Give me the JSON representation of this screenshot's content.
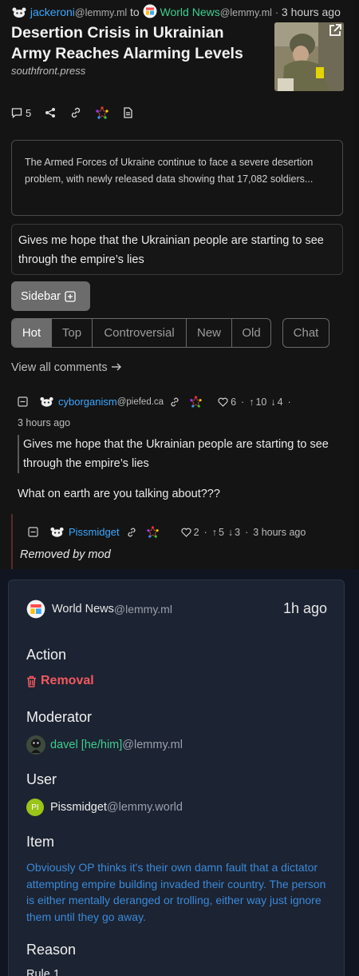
{
  "post": {
    "author": "jackeroni",
    "author_instance": "@lemmy.ml",
    "to_label": "to",
    "community": "World News",
    "community_instance": "@lemmy.ml",
    "time": "3 hours ago",
    "title": "Desertion Crisis in Ukrainian Army Reaches Alarming Levels",
    "source": "southfront.press",
    "comment_count": "5",
    "excerpt": "The Armed Forces of Ukraine continue to face a severe desertion problem, with newly released data showing that 17,082 soldiers...",
    "body": "Gives me hope that the Ukrainian people are starting to see through the empire’s lies"
  },
  "sidebar_label": "Sidebar",
  "sort_tabs": [
    "Hot",
    "Top",
    "Controversial",
    "New",
    "Old"
  ],
  "chat_label": "Chat",
  "view_all": "View all comments",
  "comments": [
    {
      "user": "cyborganism",
      "instance": "@piefed.ca",
      "upvotes_label": "6",
      "up": "10",
      "down": "4",
      "sep": "·",
      "time": "3 hours ago",
      "quote": "Gives me hope that the Ukrainian people are starting to see through the empire’s lies",
      "text": "What on earth are you talking about???"
    },
    {
      "user": "Pissmidget",
      "hearts": "2",
      "up": "5",
      "down": "3",
      "sep": "·",
      "time": "3 hours ago",
      "text": "Removed by mod"
    }
  ],
  "modlog": {
    "community": "World News",
    "community_instance": "@lemmy.ml",
    "time": "1h ago",
    "action_heading": "Action",
    "action": "Removal",
    "moderator_heading": "Moderator",
    "moderator": "davel [he/him]",
    "moderator_instance": "@lemmy.ml",
    "user_heading": "User",
    "user_initials": "PI",
    "user": "Pissmidget",
    "user_instance": "@lemmy.world",
    "item_heading": "Item",
    "item": "Obviously OP thinks it's their own damn fault that a dictator attempting empire building invaded their country. The person is either mentally deranged or trolling, either way just ignore them until they go away.",
    "reason_heading": "Reason",
    "reason": "Rule 1"
  },
  "colors": {
    "link_blue": "#3ba7ff",
    "community_green": "#3ccf8e",
    "removal_red": "#f0595f",
    "modlog_bg": "#1c2332"
  }
}
